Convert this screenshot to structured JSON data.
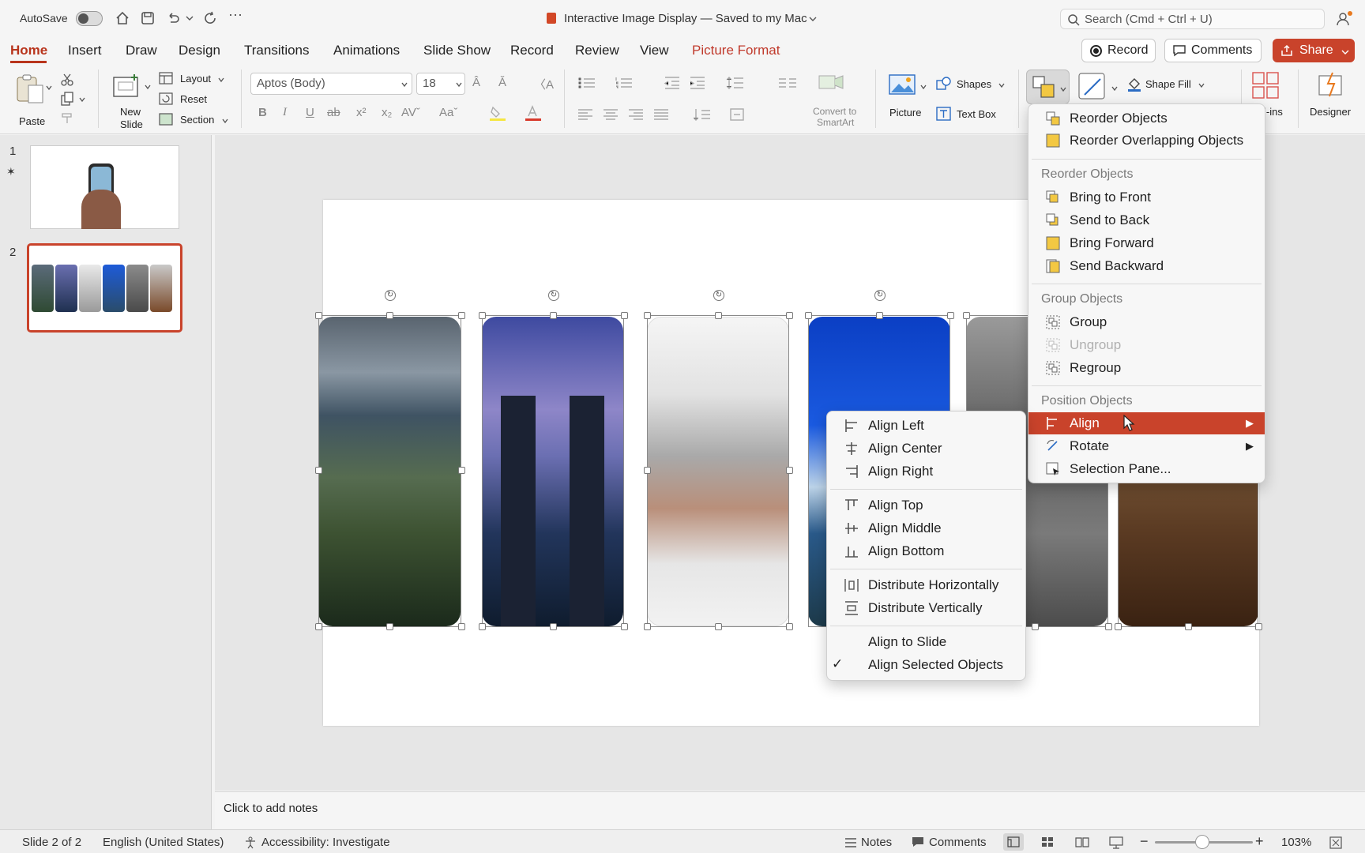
{
  "titlebar": {
    "autosave_label": "AutoSave",
    "document_title": "Interactive Image Display — Saved to my Mac",
    "search_placeholder": "Search (Cmd + Ctrl + U)"
  },
  "tabs": [
    "Home",
    "Insert",
    "Draw",
    "Design",
    "Transitions",
    "Animations",
    "Slide Show",
    "Record",
    "Review",
    "View",
    "Picture Format"
  ],
  "header_buttons": {
    "record": "Record",
    "comments": "Comments",
    "share": "Share"
  },
  "ribbon": {
    "paste": "Paste",
    "new_slide_line1": "New",
    "new_slide_line2": "Slide",
    "layout": "Layout",
    "reset": "Reset",
    "section": "Section",
    "font_name": "Aptos (Body)",
    "font_size": "18",
    "convert_line1": "Convert to",
    "convert_line2": "SmartArt",
    "picture": "Picture",
    "shapes": "Shapes",
    "text_box": "Text Box",
    "shape_fill": "Shape Fill",
    "addins": "l-ins",
    "designer": "Designer"
  },
  "thumbnails": {
    "slide1_number": "1",
    "slide2_number": "2"
  },
  "notes_placeholder": "Click to add notes",
  "status": {
    "slide_count": "Slide 2 of 2",
    "language": "English (United States)",
    "accessibility": "Accessibility: Investigate",
    "notes": "Notes",
    "comments": "Comments",
    "zoom": "103%"
  },
  "arrange_menu": {
    "items_top": [
      "Reorder Objects",
      "Reorder Overlapping Objects"
    ],
    "section_reorder": "Reorder Objects",
    "reorder_items": [
      "Bring to Front",
      "Send to Back",
      "Bring Forward",
      "Send Backward"
    ],
    "section_group": "Group Objects",
    "group_items": [
      "Group",
      "Ungroup",
      "Regroup"
    ],
    "section_position": "Position Objects",
    "position_items": [
      "Align",
      "Rotate",
      "Selection Pane..."
    ]
  },
  "align_submenu": {
    "group1": [
      "Align Left",
      "Align Center",
      "Align Right"
    ],
    "group2": [
      "Align Top",
      "Align Middle",
      "Align Bottom"
    ],
    "group3": [
      "Distribute Horizontally",
      "Distribute Vertically"
    ],
    "group4": [
      "Align to Slide",
      "Align Selected Objects"
    ],
    "checkmark": "✓"
  },
  "colors": {
    "accent": "#c9432b",
    "tab_active": "#b8341c"
  }
}
